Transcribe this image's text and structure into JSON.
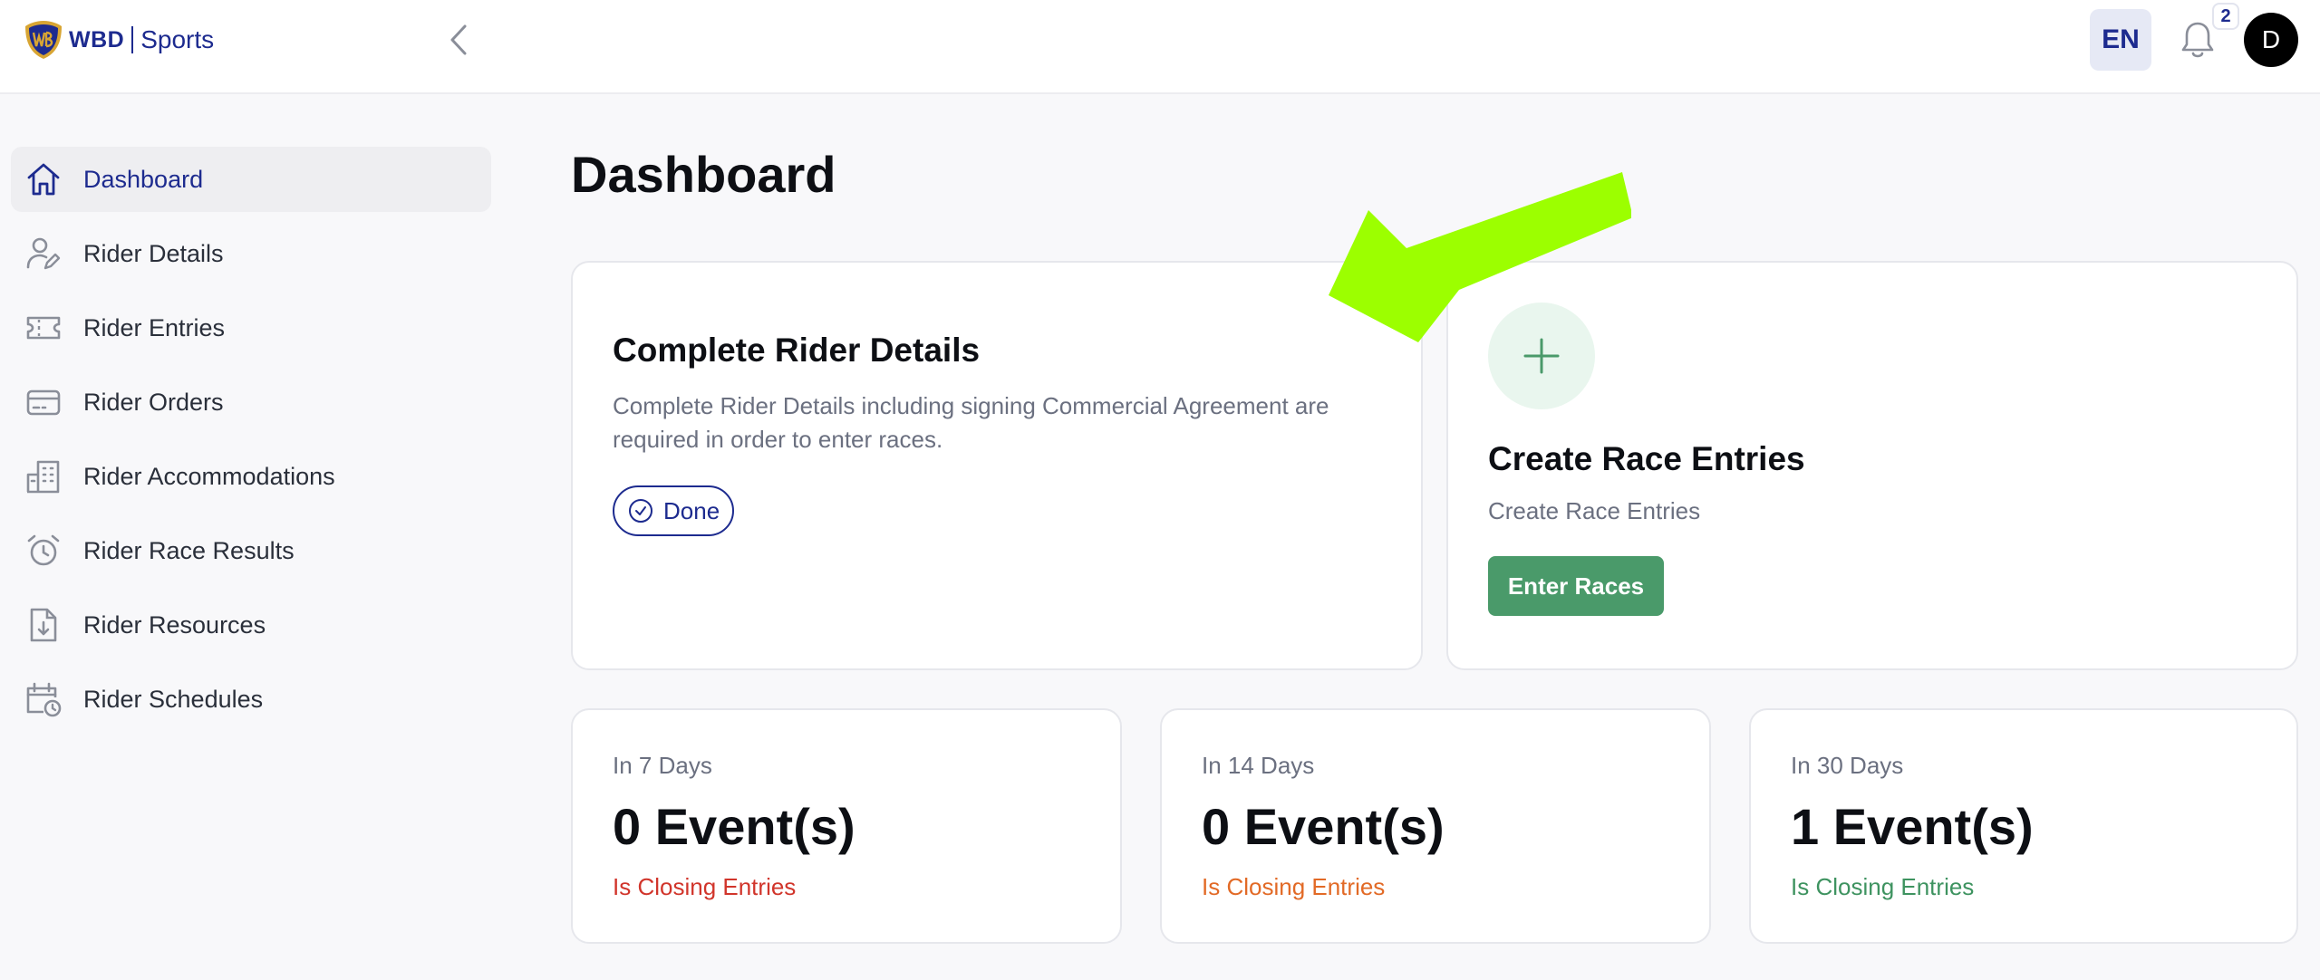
{
  "header": {
    "brand_wbd": "WBD",
    "brand_sports": "Sports",
    "language": "EN",
    "notification_count": "2",
    "avatar_initial": "D"
  },
  "sidebar": {
    "items": [
      {
        "label": "Dashboard",
        "icon": "home-icon",
        "active": true
      },
      {
        "label": "Rider Details",
        "icon": "user-edit-icon"
      },
      {
        "label": "Rider Entries",
        "icon": "ticket-icon"
      },
      {
        "label": "Rider Orders",
        "icon": "credit-card-icon"
      },
      {
        "label": "Rider Accommodations",
        "icon": "building-icon"
      },
      {
        "label": "Rider Race Results",
        "icon": "alarm-clock-icon"
      },
      {
        "label": "Rider Resources",
        "icon": "file-download-icon"
      },
      {
        "label": "Rider Schedules",
        "icon": "calendar-clock-icon"
      }
    ]
  },
  "main": {
    "title": "Dashboard",
    "rider_details_card": {
      "title": "Complete Rider Details",
      "description": "Complete Rider Details including signing Commercial Agreement are required in order to enter races.",
      "status_label": "Done"
    },
    "race_entries_card": {
      "title": "Create Race Entries",
      "description": "Create Race Entries",
      "button_label": "Enter Races"
    },
    "stats": [
      {
        "period": "In 7 Days",
        "value": "0 Event(s)",
        "sub": "Is Closing Entries",
        "color": "#d1352b"
      },
      {
        "period": "In 14 Days",
        "value": "0 Event(s)",
        "sub": "Is Closing Entries",
        "color": "#e26a26"
      },
      {
        "period": "In 30 Days",
        "value": "1 Event(s)",
        "sub": "Is Closing Entries",
        "color": "#3e9360"
      }
    ]
  },
  "colors": {
    "brand": "#1d2b8f",
    "success": "#4a9a6a",
    "annotation_arrow": "#9cff00"
  }
}
